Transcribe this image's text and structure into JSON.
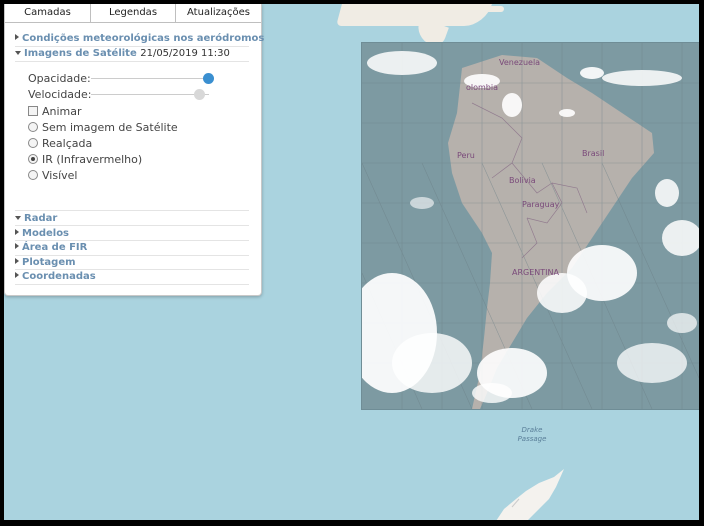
{
  "tabs": [
    {
      "label": "Camadas"
    },
    {
      "label": "Legendas"
    },
    {
      "label": "Atualizações"
    }
  ],
  "sections": {
    "aerodromos": {
      "label": "Condições meteorológicas nos aeródromos"
    },
    "satelite": {
      "label": "Imagens de Satélite",
      "date": "21/05/2019 11:30"
    },
    "radar": {
      "label": "Radar"
    },
    "modelos": {
      "label": "Modelos"
    },
    "fir": {
      "label": "Área de FIR"
    },
    "plotagem": {
      "label": "Plotagem"
    },
    "coordenadas": {
      "label": "Coordenadas"
    }
  },
  "satellite_controls": {
    "opacity": {
      "label": "Opacidade:",
      "value": 1.0,
      "color": "#3a8fd0"
    },
    "speed": {
      "label": "Velocidade:",
      "value": 1.0,
      "color": "#d8d8d8"
    },
    "animate": {
      "label": "Animar",
      "checked": false
    },
    "options": [
      {
        "label": "Sem imagem de Satélite",
        "selected": false
      },
      {
        "label": "Realçada",
        "selected": false
      },
      {
        "label": "IR (Infravermelho)",
        "selected": true
      },
      {
        "label": "Visível",
        "selected": false
      }
    ]
  },
  "map": {
    "labels": {
      "venezuela": "Venezuela",
      "colombia": "olombia",
      "peru": "Peru",
      "brasil": "Brasil",
      "bolivia": "Bolivia",
      "paraguay": "Paraguay",
      "argentina": "ARGENTINA",
      "drake_line1": "Drake",
      "drake_line2": "Passage"
    },
    "colors": {
      "ocean": "#aad3df",
      "land": "#f0ece4",
      "satellite_background": "#7d9aa2",
      "continent": "#b9b2ad",
      "clouds": "#ffffff"
    }
  }
}
